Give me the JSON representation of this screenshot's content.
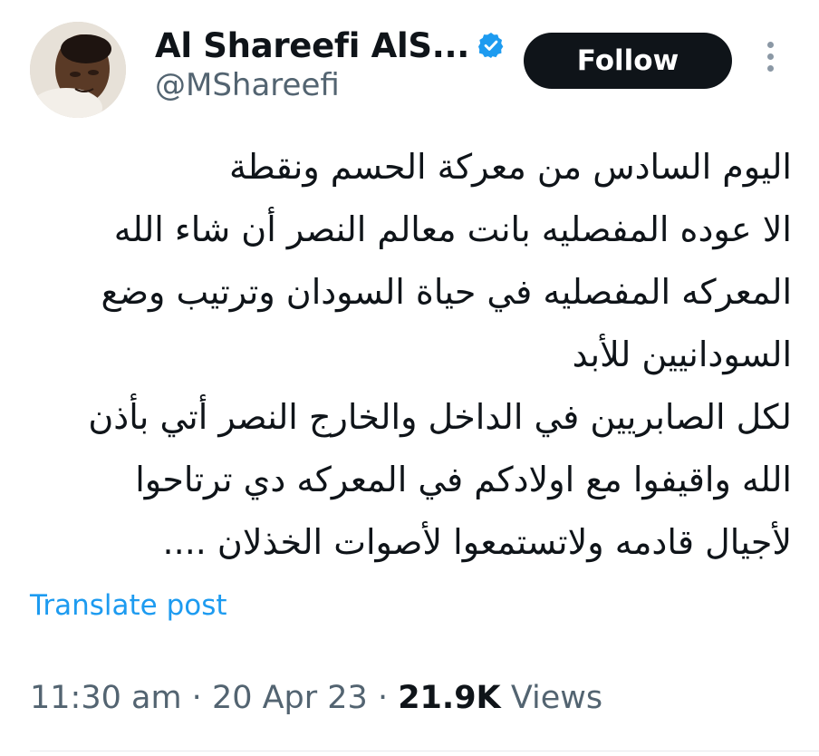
{
  "author": {
    "display_name": "Al Shareefi AlS...",
    "handle": "@MShareefi",
    "verified": true,
    "verified_color": "#1d9bf0"
  },
  "actions": {
    "follow_label": "Follow",
    "more_icon": "more-vertical-icon"
  },
  "tweet": {
    "lines": [
      "اليوم السادس من معركة الحسم ونقطة",
      "الا عوده المفصليه بانت معالم النصر أن شاء الله",
      "المعركه المفصليه في حياة السودان وترتيب وضع",
      "السودانيين للأبد",
      "لكل الصابريين في الداخل والخارج النصر أتي بأذن",
      "الله واقيفوا مع اولادكم في المعركه دي ترتاحوا",
      "لأجيال قادمه ولاتستمعوا لأصوات الخذلان ...."
    ]
  },
  "translate_label": "Translate post",
  "meta": {
    "time": "11:30 am",
    "separator": " · ",
    "date": "20 Apr 23",
    "views_count": "21.9K",
    "views_label": "Views"
  },
  "colors": {
    "text": "#0f1419",
    "secondary": "#536471",
    "link": "#1d9bf0",
    "button_bg": "#0f1419"
  }
}
